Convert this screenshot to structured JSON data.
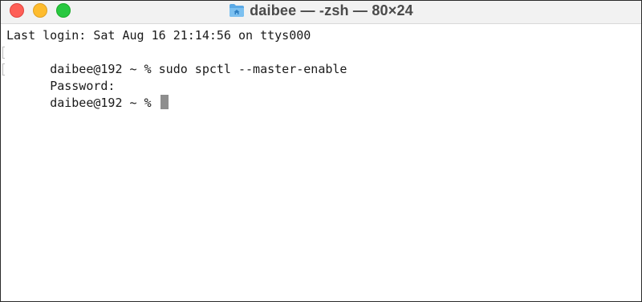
{
  "window": {
    "title": "daibee — -zsh — 80×24",
    "title_icon": "folder-home-icon"
  },
  "traffic_lights": {
    "close_color": "#fe5f57",
    "minimize_color": "#febc2e",
    "maximize_color": "#28c840"
  },
  "terminal": {
    "lines": [
      "Last login: Sat Aug 16 21:14:56 on ttys000",
      "daibee@192 ~ % sudo spctl --master-enable",
      "Password:"
    ],
    "prompt": "daibee@192 ~ % ",
    "cursor_color": "#8e8e8e"
  }
}
